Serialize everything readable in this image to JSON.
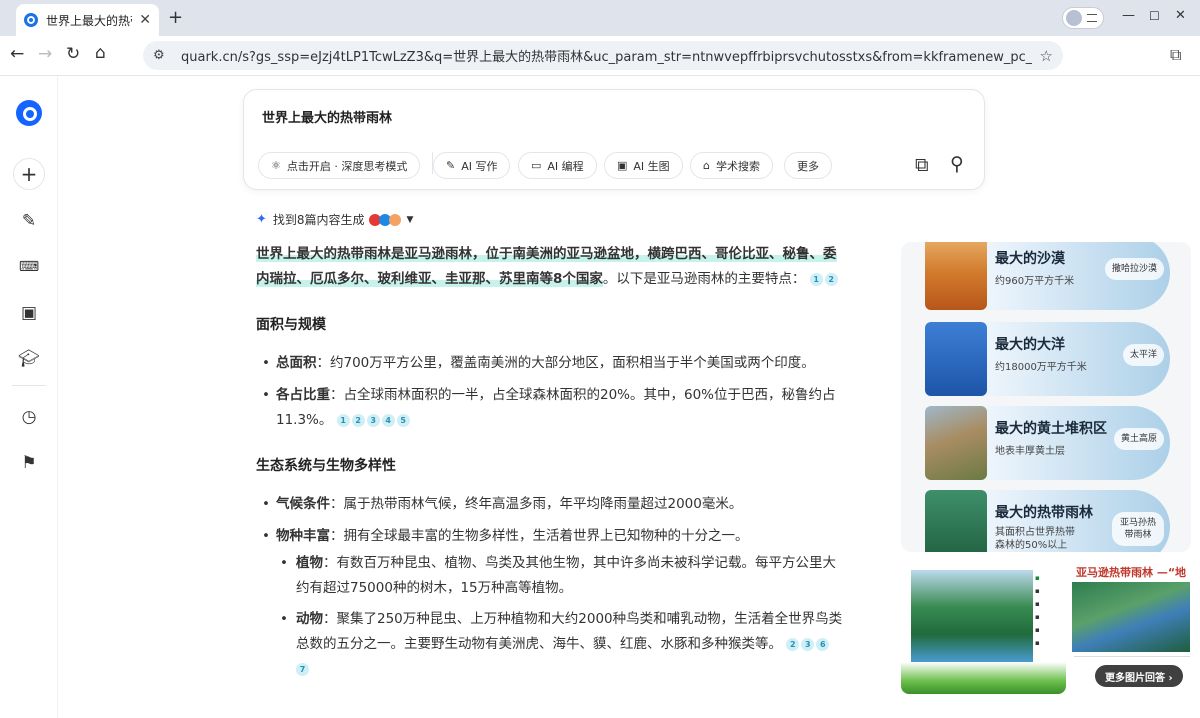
{
  "browser": {
    "tab_title": "世界上最大的热带雨林",
    "url": "quark.cn/s?gs_ssp=eJzj4tLP1TcwLzZ3&q=世界上最大的热带雨林&uc_param_str=ntnwvepffrbiprsvchutosstxs&from=kkframenew_pc_top_addres..."
  },
  "search": {
    "query": "世界上最大的热带雨林",
    "chips": [
      "点击开启 · 深度思考模式",
      "AI 写作",
      "AI 编程",
      "AI 生图",
      "学术搜索",
      "更多"
    ]
  },
  "answer": {
    "found_text": "找到8篇内容生成",
    "intro_highlight": "世界上最大的热带雨林是亚马逊雨林，位于南美洲的亚马逊盆地，横跨巴西、哥伦比亚、秘鲁、委内瑞拉、厄瓜多尔、玻利维亚、圭亚那、苏里南等8个国家",
    "intro_rest": "。以下是亚马逊雨林的主要特点：",
    "intro_cites": [
      "1",
      "2"
    ],
    "section1_title": "面积与规模",
    "s1_item1_label": "总面积",
    "s1_item1_text": "：约700万平方公里，覆盖南美洲的大部分地区，面积相当于半个美国或两个印度。",
    "s1_item2_label": "各占比重",
    "s1_item2_text": "：占全球雨林面积的一半，占全球森林面积的20%。其中，60%位于巴西，秘鲁约占11.3%。",
    "s1_item2_cites": [
      "1",
      "2",
      "3",
      "4",
      "5"
    ],
    "section2_title": "生态系统与生物多样性",
    "s2_item1_label": "气候条件",
    "s2_item1_text": "：属于热带雨林气候，终年高温多雨，年平均降雨量超过2000毫米。",
    "s2_item2_label": "物种丰富",
    "s2_item2_text": "：拥有全球最丰富的生物多样性，生活着世界上已知物种的十分之一。",
    "s2_sub1_label": "植物",
    "s2_sub1_text": "：有数百万种昆虫、植物、鸟类及其他生物，其中许多尚未被科学记载。每平方公里大约有超过75000种的树木，15万种高等植物。",
    "s2_sub2_label": "动物",
    "s2_sub2_text": "：聚集了250万种昆虫、上万种植物和大约2000种鸟类和哺乳动物，生活着全世界鸟类总数的五分之一。主要野生动物有美洲虎、海牛、貘、红鹿、水豚和多种猴类等。",
    "s2_sub2_cites": [
      "2",
      "3",
      "6",
      "7"
    ]
  },
  "image_cards": [
    {
      "title": "最大的沙漠",
      "sub": "约960万平方千米",
      "tag": "撒哈拉沙漠"
    },
    {
      "title": "最大的大洋",
      "sub": "约18000万平方千米",
      "tag": "太平洋"
    },
    {
      "title": "最大的黄土堆积区",
      "sub": "地表丰厚黄土层",
      "tag": "黄土高原"
    },
    {
      "title": "最大的热带雨林",
      "sub": "其面积占世界热带森林的50%以上",
      "tag": "亚马孙热带雨林"
    }
  ],
  "pic2_title": "亚马逊热带雨林 —“地",
  "more_images": "更多图片回答 ›"
}
